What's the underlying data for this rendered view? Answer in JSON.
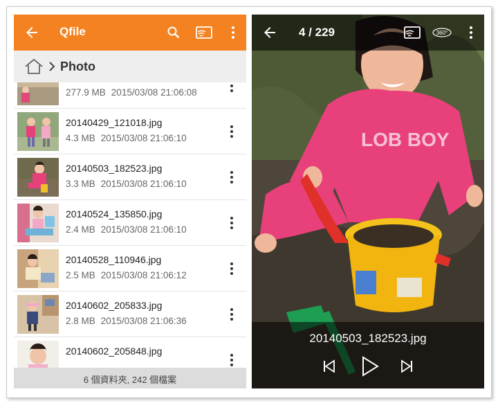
{
  "left_panel": {
    "app_title": "Qfile",
    "breadcrumb": {
      "current": "Photo"
    },
    "files": [
      {
        "name": "",
        "size": "277.9 MB",
        "date": "2015/03/08 21:06:08"
      },
      {
        "name": "20140429_121018.jpg",
        "size": "4.3 MB",
        "date": "2015/03/08 21:06:10"
      },
      {
        "name": "20140503_182523.jpg",
        "size": "3.3 MB",
        "date": "2015/03/08 21:06:10"
      },
      {
        "name": "20140524_135850.jpg",
        "size": "2.4 MB",
        "date": "2015/03/08 21:06:10"
      },
      {
        "name": "20140528_110946.jpg",
        "size": "2.5 MB",
        "date": "2015/03/08 21:06:12"
      },
      {
        "name": "20140602_205833.jpg",
        "size": "2.8 MB",
        "date": "2015/03/08 21:06:36"
      },
      {
        "name": "20140602_205848.jpg",
        "size": "",
        "date": ""
      }
    ],
    "footer": "6 個資料夾, 242 個檔案"
  },
  "right_panel": {
    "counter": "4 / 229",
    "pano_label": "360°",
    "photo_shirt_text": "LOB BOY",
    "file_name": "20140503_182523.jpg"
  },
  "colors": {
    "accent": "#f58220",
    "breadcrumb_bg": "#eeeeee",
    "footer_bg": "#dcdcdc"
  },
  "icons": {
    "back": "arrow-left-icon",
    "search": "search-icon",
    "cast": "cast-icon",
    "more": "more-vert-icon",
    "home": "home-icon",
    "chevron": "chevron-right-icon",
    "pano": "360-view-icon",
    "prev": "skip-previous-icon",
    "play": "play-icon",
    "next": "skip-next-icon"
  }
}
